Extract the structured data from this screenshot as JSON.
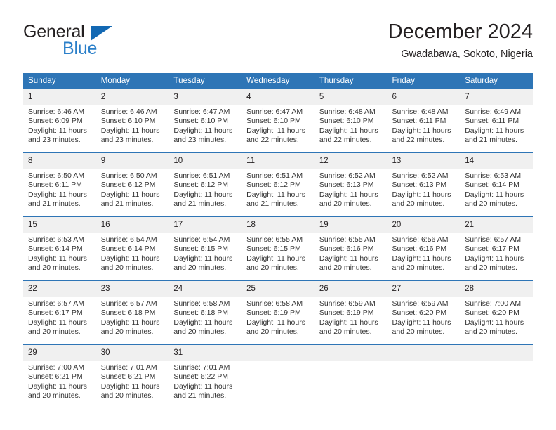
{
  "brand": {
    "name_part1": "General",
    "name_part2": "Blue",
    "logo_icon": "triangle-logo-icon"
  },
  "header": {
    "title": "December 2024",
    "location": "Gwadabawa, Sokoto, Nigeria"
  },
  "colors": {
    "header_blue": "#2E75B6",
    "brand_blue": "#2A7FC9",
    "logo_blue": "#1268B3",
    "daynum_band": "#F0F0F0",
    "text": "#231F20"
  },
  "weekday_headers": [
    "Sunday",
    "Monday",
    "Tuesday",
    "Wednesday",
    "Thursday",
    "Friday",
    "Saturday"
  ],
  "weeks": [
    [
      {
        "date": "1",
        "lines": [
          "Sunrise: 6:46 AM",
          "Sunset: 6:09 PM",
          "Daylight: 11 hours",
          "and 23 minutes."
        ]
      },
      {
        "date": "2",
        "lines": [
          "Sunrise: 6:46 AM",
          "Sunset: 6:10 PM",
          "Daylight: 11 hours",
          "and 23 minutes."
        ]
      },
      {
        "date": "3",
        "lines": [
          "Sunrise: 6:47 AM",
          "Sunset: 6:10 PM",
          "Daylight: 11 hours",
          "and 23 minutes."
        ]
      },
      {
        "date": "4",
        "lines": [
          "Sunrise: 6:47 AM",
          "Sunset: 6:10 PM",
          "Daylight: 11 hours",
          "and 22 minutes."
        ]
      },
      {
        "date": "5",
        "lines": [
          "Sunrise: 6:48 AM",
          "Sunset: 6:10 PM",
          "Daylight: 11 hours",
          "and 22 minutes."
        ]
      },
      {
        "date": "6",
        "lines": [
          "Sunrise: 6:48 AM",
          "Sunset: 6:11 PM",
          "Daylight: 11 hours",
          "and 22 minutes."
        ]
      },
      {
        "date": "7",
        "lines": [
          "Sunrise: 6:49 AM",
          "Sunset: 6:11 PM",
          "Daylight: 11 hours",
          "and 21 minutes."
        ]
      }
    ],
    [
      {
        "date": "8",
        "lines": [
          "Sunrise: 6:50 AM",
          "Sunset: 6:11 PM",
          "Daylight: 11 hours",
          "and 21 minutes."
        ]
      },
      {
        "date": "9",
        "lines": [
          "Sunrise: 6:50 AM",
          "Sunset: 6:12 PM",
          "Daylight: 11 hours",
          "and 21 minutes."
        ]
      },
      {
        "date": "10",
        "lines": [
          "Sunrise: 6:51 AM",
          "Sunset: 6:12 PM",
          "Daylight: 11 hours",
          "and 21 minutes."
        ]
      },
      {
        "date": "11",
        "lines": [
          "Sunrise: 6:51 AM",
          "Sunset: 6:12 PM",
          "Daylight: 11 hours",
          "and 21 minutes."
        ]
      },
      {
        "date": "12",
        "lines": [
          "Sunrise: 6:52 AM",
          "Sunset: 6:13 PM",
          "Daylight: 11 hours",
          "and 20 minutes."
        ]
      },
      {
        "date": "13",
        "lines": [
          "Sunrise: 6:52 AM",
          "Sunset: 6:13 PM",
          "Daylight: 11 hours",
          "and 20 minutes."
        ]
      },
      {
        "date": "14",
        "lines": [
          "Sunrise: 6:53 AM",
          "Sunset: 6:14 PM",
          "Daylight: 11 hours",
          "and 20 minutes."
        ]
      }
    ],
    [
      {
        "date": "15",
        "lines": [
          "Sunrise: 6:53 AM",
          "Sunset: 6:14 PM",
          "Daylight: 11 hours",
          "and 20 minutes."
        ]
      },
      {
        "date": "16",
        "lines": [
          "Sunrise: 6:54 AM",
          "Sunset: 6:14 PM",
          "Daylight: 11 hours",
          "and 20 minutes."
        ]
      },
      {
        "date": "17",
        "lines": [
          "Sunrise: 6:54 AM",
          "Sunset: 6:15 PM",
          "Daylight: 11 hours",
          "and 20 minutes."
        ]
      },
      {
        "date": "18",
        "lines": [
          "Sunrise: 6:55 AM",
          "Sunset: 6:15 PM",
          "Daylight: 11 hours",
          "and 20 minutes."
        ]
      },
      {
        "date": "19",
        "lines": [
          "Sunrise: 6:55 AM",
          "Sunset: 6:16 PM",
          "Daylight: 11 hours",
          "and 20 minutes."
        ]
      },
      {
        "date": "20",
        "lines": [
          "Sunrise: 6:56 AM",
          "Sunset: 6:16 PM",
          "Daylight: 11 hours",
          "and 20 minutes."
        ]
      },
      {
        "date": "21",
        "lines": [
          "Sunrise: 6:57 AM",
          "Sunset: 6:17 PM",
          "Daylight: 11 hours",
          "and 20 minutes."
        ]
      }
    ],
    [
      {
        "date": "22",
        "lines": [
          "Sunrise: 6:57 AM",
          "Sunset: 6:17 PM",
          "Daylight: 11 hours",
          "and 20 minutes."
        ]
      },
      {
        "date": "23",
        "lines": [
          "Sunrise: 6:57 AM",
          "Sunset: 6:18 PM",
          "Daylight: 11 hours",
          "and 20 minutes."
        ]
      },
      {
        "date": "24",
        "lines": [
          "Sunrise: 6:58 AM",
          "Sunset: 6:18 PM",
          "Daylight: 11 hours",
          "and 20 minutes."
        ]
      },
      {
        "date": "25",
        "lines": [
          "Sunrise: 6:58 AM",
          "Sunset: 6:19 PM",
          "Daylight: 11 hours",
          "and 20 minutes."
        ]
      },
      {
        "date": "26",
        "lines": [
          "Sunrise: 6:59 AM",
          "Sunset: 6:19 PM",
          "Daylight: 11 hours",
          "and 20 minutes."
        ]
      },
      {
        "date": "27",
        "lines": [
          "Sunrise: 6:59 AM",
          "Sunset: 6:20 PM",
          "Daylight: 11 hours",
          "and 20 minutes."
        ]
      },
      {
        "date": "28",
        "lines": [
          "Sunrise: 7:00 AM",
          "Sunset: 6:20 PM",
          "Daylight: 11 hours",
          "and 20 minutes."
        ]
      }
    ],
    [
      {
        "date": "29",
        "lines": [
          "Sunrise: 7:00 AM",
          "Sunset: 6:21 PM",
          "Daylight: 11 hours",
          "and 20 minutes."
        ]
      },
      {
        "date": "30",
        "lines": [
          "Sunrise: 7:01 AM",
          "Sunset: 6:21 PM",
          "Daylight: 11 hours",
          "and 20 minutes."
        ]
      },
      {
        "date": "31",
        "lines": [
          "Sunrise: 7:01 AM",
          "Sunset: 6:22 PM",
          "Daylight: 11 hours",
          "and 21 minutes."
        ]
      },
      {
        "date": "",
        "lines": []
      },
      {
        "date": "",
        "lines": []
      },
      {
        "date": "",
        "lines": []
      },
      {
        "date": "",
        "lines": []
      }
    ]
  ]
}
